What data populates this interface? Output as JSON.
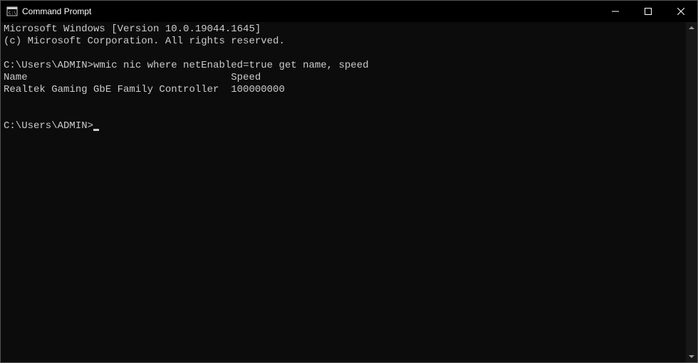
{
  "window": {
    "title": "Command Prompt"
  },
  "terminal": {
    "line1": "Microsoft Windows [Version 10.0.19044.1645]",
    "line2": "(c) Microsoft Corporation. All rights reserved.",
    "blank1": "",
    "prompt1_path": "C:\\Users\\ADMIN>",
    "prompt1_cmd": "wmic nic where netEnabled=true get name, speed",
    "header_row": "Name                                  Speed",
    "data_row": "Realtek Gaming GbE Family Controller  100000000",
    "blank2": "",
    "blank3": "",
    "prompt2_path": "C:\\Users\\ADMIN>"
  }
}
